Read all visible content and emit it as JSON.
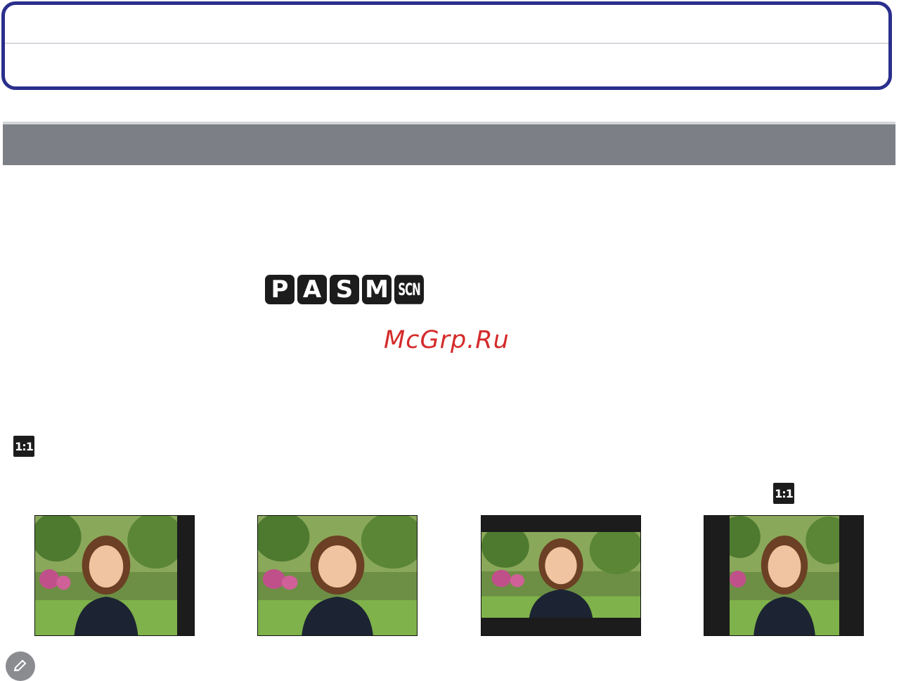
{
  "mode_icons": [
    "P",
    "A",
    "S",
    "M",
    "SCN"
  ],
  "watermark": "McGrp.Ru",
  "aspect_icon_label": "1:1",
  "photos": [
    {
      "name": "aspect-4-3"
    },
    {
      "name": "aspect-3-2"
    },
    {
      "name": "aspect-16-9"
    },
    {
      "name": "aspect-1-1"
    }
  ],
  "icons": {
    "note": "pencil-note-icon"
  },
  "colors": {
    "title_border": "#2a2f8c",
    "section_bar": "#7c7f85",
    "watermark": "#d42a2a",
    "icon_bg": "#1c1c1c"
  }
}
